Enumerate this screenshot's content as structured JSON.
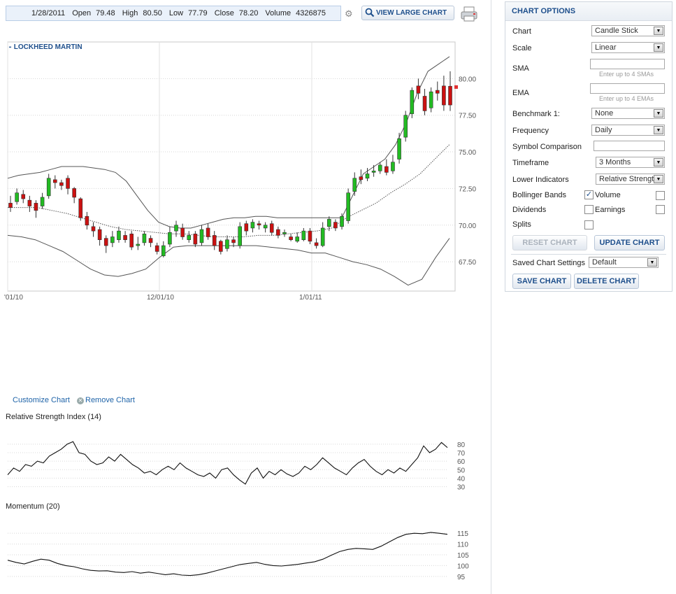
{
  "quote": {
    "date": "1/28/2011",
    "open_label": "Open",
    "open": "79.48",
    "high_label": "High",
    "high": "80.50",
    "low_label": "Low",
    "low": "77.79",
    "close_label": "Close",
    "close": "78.20",
    "volume_label": "Volume",
    "volume": "4326875"
  },
  "toolbar": {
    "view_large_label": "VIEW LARGE CHART",
    "icons": [
      "gear-icon",
      "magnifier-icon",
      "print-icon"
    ]
  },
  "main_chart": {
    "tag": "LOCKHEED MARTIN",
    "y_ticks": [
      "80.00",
      "77.50",
      "75.00",
      "72.50",
      "70.00",
      "67.50"
    ],
    "x_ticks": [
      "'01/10",
      "12/01/10",
      "1/01/11"
    ],
    "colors": {
      "up": "#22bb22",
      "down": "#cc1111",
      "band": "#555555",
      "marker": "#e03030"
    }
  },
  "links": {
    "customize": "Customize Chart",
    "remove": "Remove Chart"
  },
  "rsi": {
    "title": "Relative Strength Index (14)",
    "ticks": [
      "80",
      "70",
      "60",
      "50",
      "40",
      "30"
    ]
  },
  "momentum": {
    "title": "Momentum (20)",
    "ticks": [
      "115",
      "110",
      "105",
      "100",
      "95"
    ]
  },
  "chart_data": [
    {
      "type": "candlestick",
      "title": "LOCKHEED MARTIN",
      "ylim": [
        65.5,
        82.5
      ],
      "x_ticks": [
        "'01/10",
        "12/01/10",
        "1/01/11"
      ],
      "candles": [
        [
          71.5,
          71.2,
          72.0,
          70.9
        ],
        [
          71.6,
          72.2,
          72.5,
          71.4
        ],
        [
          72.1,
          71.8,
          72.4,
          71.5
        ],
        [
          71.7,
          71.3,
          72.0,
          70.9
        ],
        [
          71.5,
          71.0,
          71.7,
          70.5
        ],
        [
          71.3,
          71.9,
          72.2,
          71.1
        ],
        [
          72.0,
          73.2,
          73.5,
          71.8
        ],
        [
          73.1,
          72.9,
          73.4,
          72.5
        ],
        [
          72.9,
          72.7,
          73.1,
          72.4
        ],
        [
          73.2,
          72.5,
          73.4,
          72.1
        ],
        [
          72.5,
          71.9,
          72.6,
          71.5
        ],
        [
          71.8,
          70.5,
          71.9,
          70.3
        ],
        [
          70.6,
          70.0,
          70.9,
          69.7
        ],
        [
          69.9,
          69.6,
          70.2,
          69.2
        ],
        [
          69.7,
          69.0,
          69.9,
          68.6
        ],
        [
          69.1,
          68.6,
          69.3,
          68.1
        ],
        [
          68.8,
          69.2,
          69.6,
          68.5
        ],
        [
          69.0,
          69.6,
          69.9,
          68.8
        ],
        [
          69.3,
          69.0,
          69.6,
          68.8
        ],
        [
          69.4,
          68.5,
          69.6,
          68.3
        ],
        [
          68.6,
          68.7,
          69.2,
          68.3
        ],
        [
          68.8,
          69.4,
          69.6,
          68.6
        ],
        [
          69.1,
          68.8,
          69.3,
          68.5
        ],
        [
          68.6,
          68.2,
          68.8,
          68.0
        ],
        [
          67.9,
          68.6,
          68.9,
          67.8
        ],
        [
          68.7,
          69.5,
          69.9,
          68.5
        ],
        [
          69.6,
          70.0,
          70.3,
          69.2
        ],
        [
          69.8,
          69.2,
          70.1,
          69.0
        ],
        [
          69.0,
          69.3,
          69.6,
          68.8
        ],
        [
          69.4,
          68.7,
          69.6,
          68.5
        ],
        [
          68.8,
          69.7,
          70.0,
          68.6
        ],
        [
          69.8,
          69.2,
          70.1,
          69.0
        ],
        [
          69.3,
          68.6,
          69.6,
          68.3
        ],
        [
          68.9,
          68.2,
          69.0,
          68.0
        ],
        [
          68.4,
          69.0,
          69.3,
          68.2
        ],
        [
          69.0,
          68.8,
          69.2,
          68.5
        ],
        [
          68.6,
          69.9,
          70.2,
          68.4
        ],
        [
          70.1,
          69.6,
          70.3,
          69.3
        ],
        [
          69.8,
          70.2,
          70.4,
          69.5
        ],
        [
          70.1,
          70.0,
          70.3,
          69.7
        ],
        [
          69.8,
          70.0,
          70.2,
          69.5
        ],
        [
          70.1,
          69.5,
          70.3,
          69.3
        ],
        [
          69.7,
          69.3,
          69.9,
          69.1
        ],
        [
          69.4,
          69.5,
          69.7,
          69.2
        ],
        [
          69.2,
          69.0,
          69.4,
          68.9
        ],
        [
          68.9,
          69.2,
          69.5,
          68.8
        ],
        [
          69.0,
          69.6,
          69.8,
          68.9
        ],
        [
          69.6,
          68.9,
          69.8,
          68.7
        ],
        [
          68.8,
          68.6,
          69.1,
          68.4
        ],
        [
          68.6,
          69.8,
          70.2,
          68.5
        ],
        [
          69.9,
          70.4,
          70.6,
          69.6
        ],
        [
          70.2,
          69.8,
          70.4,
          69.6
        ],
        [
          69.9,
          70.6,
          70.8,
          69.7
        ],
        [
          70.3,
          72.2,
          72.5,
          70.1
        ],
        [
          72.3,
          73.2,
          73.6,
          72.0
        ],
        [
          73.3,
          73.1,
          73.8,
          72.8
        ],
        [
          73.2,
          73.5,
          73.9,
          73.0
        ],
        [
          73.6,
          73.7,
          74.1,
          73.3
        ],
        [
          73.7,
          74.1,
          74.3,
          73.5
        ],
        [
          74.0,
          73.6,
          74.5,
          73.4
        ],
        [
          73.7,
          74.3,
          74.8,
          73.5
        ],
        [
          74.5,
          75.9,
          76.3,
          74.2
        ],
        [
          76.0,
          77.5,
          77.8,
          75.7
        ],
        [
          77.6,
          79.2,
          79.4,
          77.3
        ],
        [
          79.5,
          79.0,
          80.0,
          78.6
        ],
        [
          78.8,
          77.8,
          79.3,
          77.5
        ],
        [
          78.0,
          79.1,
          79.4,
          77.7
        ],
        [
          79.2,
          79.0,
          79.8,
          78.5
        ],
        [
          79.5,
          78.2,
          80.2,
          77.8
        ],
        [
          79.48,
          78.2,
          80.5,
          77.79
        ]
      ],
      "bollinger_upper": [
        73.2,
        73.4,
        73.5,
        73.6,
        73.8,
        74.0,
        74.0,
        74.0,
        73.9,
        73.8,
        73.6,
        73.0,
        72.0,
        71.0,
        70.2,
        69.9,
        69.8,
        69.8,
        70.0,
        70.2,
        70.4,
        70.5,
        70.5,
        70.6,
        70.6,
        70.5,
        70.5,
        70.5,
        70.5,
        70.5,
        70.5,
        70.5,
        72.0,
        73.5,
        74.0,
        74.5,
        75.5,
        77.0,
        79.0,
        80.5,
        81.0,
        81.5
      ],
      "bollinger_middle": [
        71.2,
        71.2,
        71.2,
        71.0,
        70.8,
        70.5,
        70.2,
        69.9,
        69.7,
        69.6,
        69.5,
        69.4,
        69.4,
        69.3,
        69.2,
        69.2,
        69.2,
        69.3,
        69.3,
        69.4,
        69.5,
        69.6,
        69.8,
        70.5,
        71.0,
        71.5,
        72.2,
        72.8,
        73.5,
        74.5,
        75.5
      ],
      "bollinger_lower": [
        69.3,
        69.2,
        69.0,
        68.6,
        68.2,
        67.6,
        67.0,
        66.6,
        66.5,
        66.7,
        67.0,
        67.8,
        68.5,
        68.6,
        68.6,
        68.6,
        68.6,
        68.6,
        68.6,
        68.5,
        68.4,
        68.3,
        68.1,
        68.1,
        67.8,
        67.5,
        67.3,
        67.0,
        66.5,
        65.9,
        66.3,
        67.8,
        69.1
      ]
    },
    {
      "type": "line",
      "title": "Relative Strength Index (14)",
      "ylim": [
        28,
        84
      ],
      "y_ticks": [
        30,
        40,
        50,
        60,
        70,
        80
      ],
      "values": [
        44,
        52,
        48,
        56,
        54,
        60,
        58,
        66,
        70,
        74,
        80,
        83,
        70,
        68,
        60,
        56,
        58,
        65,
        60,
        68,
        62,
        56,
        52,
        46,
        48,
        44,
        50,
        54,
        50,
        58,
        52,
        48,
        44,
        42,
        46,
        40,
        50,
        52,
        44,
        38,
        33,
        46,
        52,
        40,
        48,
        44,
        50,
        45,
        42,
        46,
        54,
        50,
        56,
        64,
        58,
        52,
        48,
        44,
        52,
        58,
        62,
        54,
        48,
        44,
        50,
        46,
        52,
        48,
        56,
        64,
        78,
        70,
        74,
        82,
        76
      ]
    },
    {
      "type": "line",
      "title": "Momentum (20)",
      "ylim": [
        93,
        117
      ],
      "y_ticks": [
        95,
        100,
        105,
        110,
        115
      ],
      "values": [
        102.5,
        101.5,
        100.8,
        102.0,
        103.0,
        102.5,
        101.0,
        100.0,
        99.5,
        98.5,
        97.8,
        97.5,
        97.6,
        97.0,
        96.8,
        97.2,
        96.5,
        97.0,
        96.4,
        95.8,
        96.2,
        95.6,
        95.4,
        95.8,
        96.5,
        97.5,
        98.5,
        99.5,
        100.5,
        101.0,
        101.5,
        100.6,
        100.0,
        99.8,
        100.2,
        100.6,
        101.2,
        101.8,
        103.0,
        104.8,
        106.5,
        107.5,
        108.0,
        107.8,
        107.5,
        109.0,
        111.0,
        113.0,
        114.5,
        115.0,
        114.8,
        115.4,
        115.0,
        114.5
      ]
    }
  ],
  "options": {
    "title": "CHART OPTIONS",
    "chart_label": "Chart",
    "chart_value": "Candle Stick",
    "scale_label": "Scale",
    "scale_value": "Linear",
    "sma_label": "SMA",
    "sma_hint": "Enter up to 4 SMAs",
    "ema_label": "EMA",
    "ema_hint": "Enter up to 4 EMAs",
    "benchmark_label": "Benchmark 1:",
    "benchmark_value": "None",
    "frequency_label": "Frequency",
    "frequency_value": "Daily",
    "symbol_comparison_label": "Symbol Comparison",
    "timeframe_label": "Timeframe",
    "timeframe_value": "3 Months",
    "lower_indicators_label": "Lower Indicators",
    "lower_indicators_value": "Relative Strength",
    "bollinger_label": "Bollinger Bands",
    "bollinger_checked": true,
    "volume_label": "Volume",
    "volume_checked": false,
    "dividends_label": "Dividends",
    "dividends_checked": false,
    "earnings_label": "Earnings",
    "earnings_checked": false,
    "splits_label": "Splits",
    "splits_checked": false,
    "reset_label": "RESET CHART",
    "update_label": "UPDATE CHART",
    "saved_settings_label": "Saved Chart Settings",
    "saved_settings_value": "Default",
    "save_label": "SAVE CHART",
    "delete_label": "DELETE CHART"
  }
}
